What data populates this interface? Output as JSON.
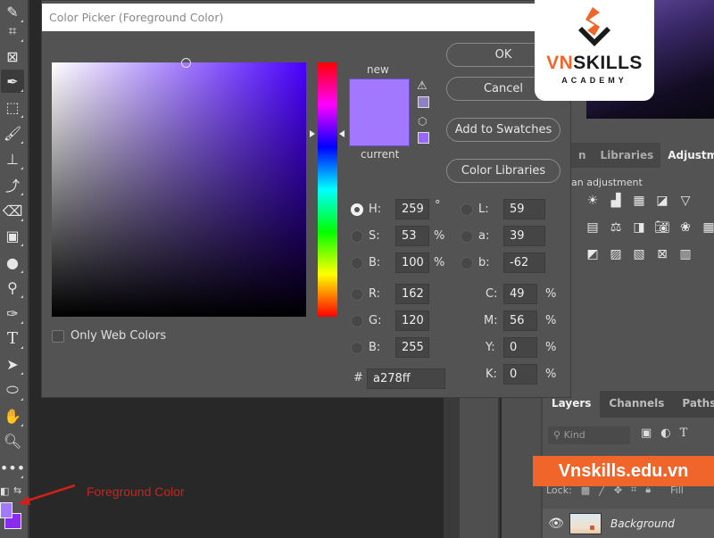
{
  "dialog": {
    "title": "Color Picker (Foreground Color)",
    "buttons": {
      "ok": "OK",
      "cancel": "Cancel",
      "add_to_swatches": "Add to Swatches",
      "color_libraries": "Color Libraries"
    },
    "labels": {
      "new": "new",
      "current": "current"
    },
    "new_color": "#a278ff",
    "current_color": "#a278ff",
    "gamut_warning_color": "#8f7fc4",
    "web_safe_color": "#9966ff",
    "only_web_colors": {
      "label": "Only Web Colors",
      "checked": false
    },
    "selected_hue_color": "#4a00ff",
    "hue_position_fraction": 0.28,
    "fields": {
      "hsb": [
        {
          "label": "H:",
          "value": "259",
          "unit": "°",
          "selected": true
        },
        {
          "label": "S:",
          "value": "53",
          "unit": "%",
          "selected": false
        },
        {
          "label": "B:",
          "value": "100",
          "unit": "%",
          "selected": false
        }
      ],
      "rgb": [
        {
          "label": "R:",
          "value": "162",
          "selected": false
        },
        {
          "label": "G:",
          "value": "120",
          "selected": false
        },
        {
          "label": "B:",
          "value": "255",
          "selected": false
        }
      ],
      "lab": [
        {
          "label": "L:",
          "value": "59",
          "selected": false
        },
        {
          "label": "a:",
          "value": "39",
          "selected": false
        },
        {
          "label": "b:",
          "value": "-62",
          "selected": false
        }
      ],
      "cmyk": [
        {
          "label": "C:",
          "value": "49",
          "unit": "%"
        },
        {
          "label": "M:",
          "value": "56",
          "unit": "%"
        },
        {
          "label": "Y:",
          "value": "0",
          "unit": "%"
        },
        {
          "label": "K:",
          "value": "0",
          "unit": "%"
        }
      ],
      "hex": {
        "label": "#",
        "value": "a278ff"
      }
    }
  },
  "toolbar": {
    "tools": [
      "brush-healing",
      "crop",
      "frame",
      "eyedropper",
      "object-select",
      "brush",
      "clone-stamp",
      "history-brush",
      "eraser",
      "gradient",
      "blur",
      "dodge",
      "pen",
      "type",
      "path-select",
      "ellipse",
      "hand",
      "zoom",
      "more"
    ],
    "active_tool": "eyedropper",
    "foreground_color": "#a278ff",
    "background_color": "#8a2cf0"
  },
  "annotation": {
    "text": "Foreground Color",
    "color": "#c4261e"
  },
  "panels": {
    "top_tabs": [
      "n",
      "Libraries",
      "Adjustments"
    ],
    "active_top_tab": "Adjustments",
    "adjustments_label": "an adjustment",
    "layers_tabs": [
      "Layers",
      "Channels",
      "Paths"
    ],
    "active_layers_tab": "Layers",
    "kind_placeholder": "Kind",
    "lock_label": "Lock:",
    "fill_label": "Fill",
    "layer": {
      "name": "Background",
      "visible": true
    }
  },
  "watermark": {
    "logo_vn": "VN",
    "logo_skills": "SKILLS",
    "logo_sub": "ACADEMY",
    "banner": "Vnskills.edu.vn",
    "brand_color": "#f0662a"
  }
}
